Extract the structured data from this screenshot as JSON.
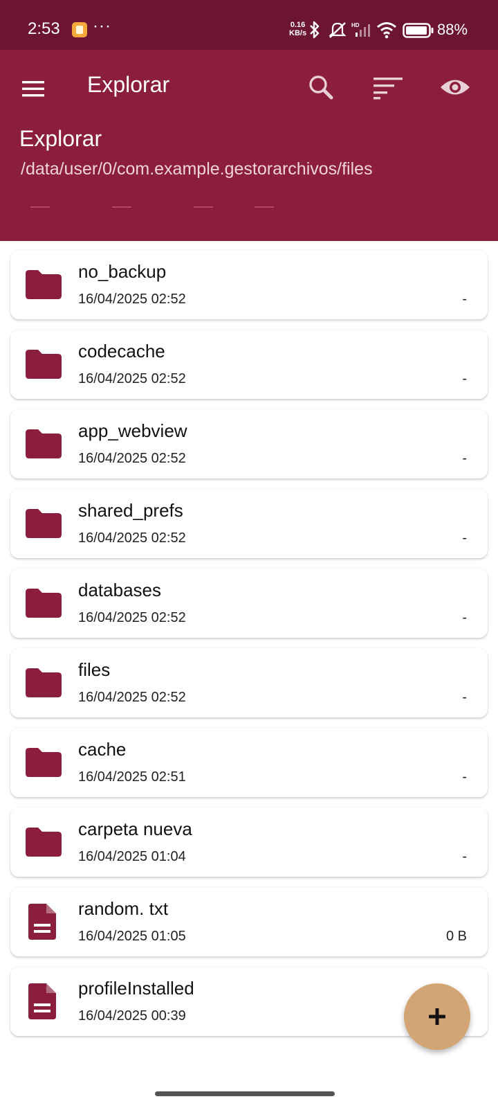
{
  "status_bar": {
    "time": "2:53",
    "more": "···",
    "net_speed_value": "0.16",
    "net_speed_unit": "KB/s",
    "battery_pct": "88%",
    "icons": [
      "notification-app-icon",
      "bluetooth-icon",
      "mute-icon",
      "signal-icon",
      "wifi-icon",
      "battery-icon"
    ]
  },
  "toolbar": {
    "title": "Explorar",
    "actions": [
      "search-icon",
      "sort-icon",
      "visibility-icon"
    ]
  },
  "header": {
    "title": "Explorar",
    "path": "/data/user/0/com.example.gestorarchivos/files"
  },
  "files": [
    {
      "name": "no_backup",
      "date": "16/04/2025 02:52",
      "size": "-",
      "type": "folder"
    },
    {
      "name": "codecache",
      "date": "16/04/2025 02:52",
      "size": "-",
      "type": "folder"
    },
    {
      "name": "app_webview",
      "date": "16/04/2025 02:52",
      "size": "-",
      "type": "folder"
    },
    {
      "name": "shared_prefs",
      "date": "16/04/2025 02:52",
      "size": "-",
      "type": "folder"
    },
    {
      "name": "databases",
      "date": "16/04/2025 02:52",
      "size": "-",
      "type": "folder"
    },
    {
      "name": "files",
      "date": "16/04/2025 02:52",
      "size": "-",
      "type": "folder"
    },
    {
      "name": "cache",
      "date": "16/04/2025 02:51",
      "size": "-",
      "type": "folder"
    },
    {
      "name": "carpeta nueva",
      "date": "16/04/2025 01:04",
      "size": "-",
      "type": "folder"
    },
    {
      "name": "random. txt",
      "date": "16/04/2025 01:05",
      "size": "0 B",
      "type": "file"
    },
    {
      "name": "profileInstalled",
      "date": "16/04/2025 00:39",
      "size": "",
      "type": "file"
    }
  ],
  "fab": {
    "symbol": "+"
  },
  "colors": {
    "status_bar": "#6b1530",
    "app_bar": "#8c1e3d",
    "icon": "#8c1e3d",
    "fab": "#d4a574"
  }
}
